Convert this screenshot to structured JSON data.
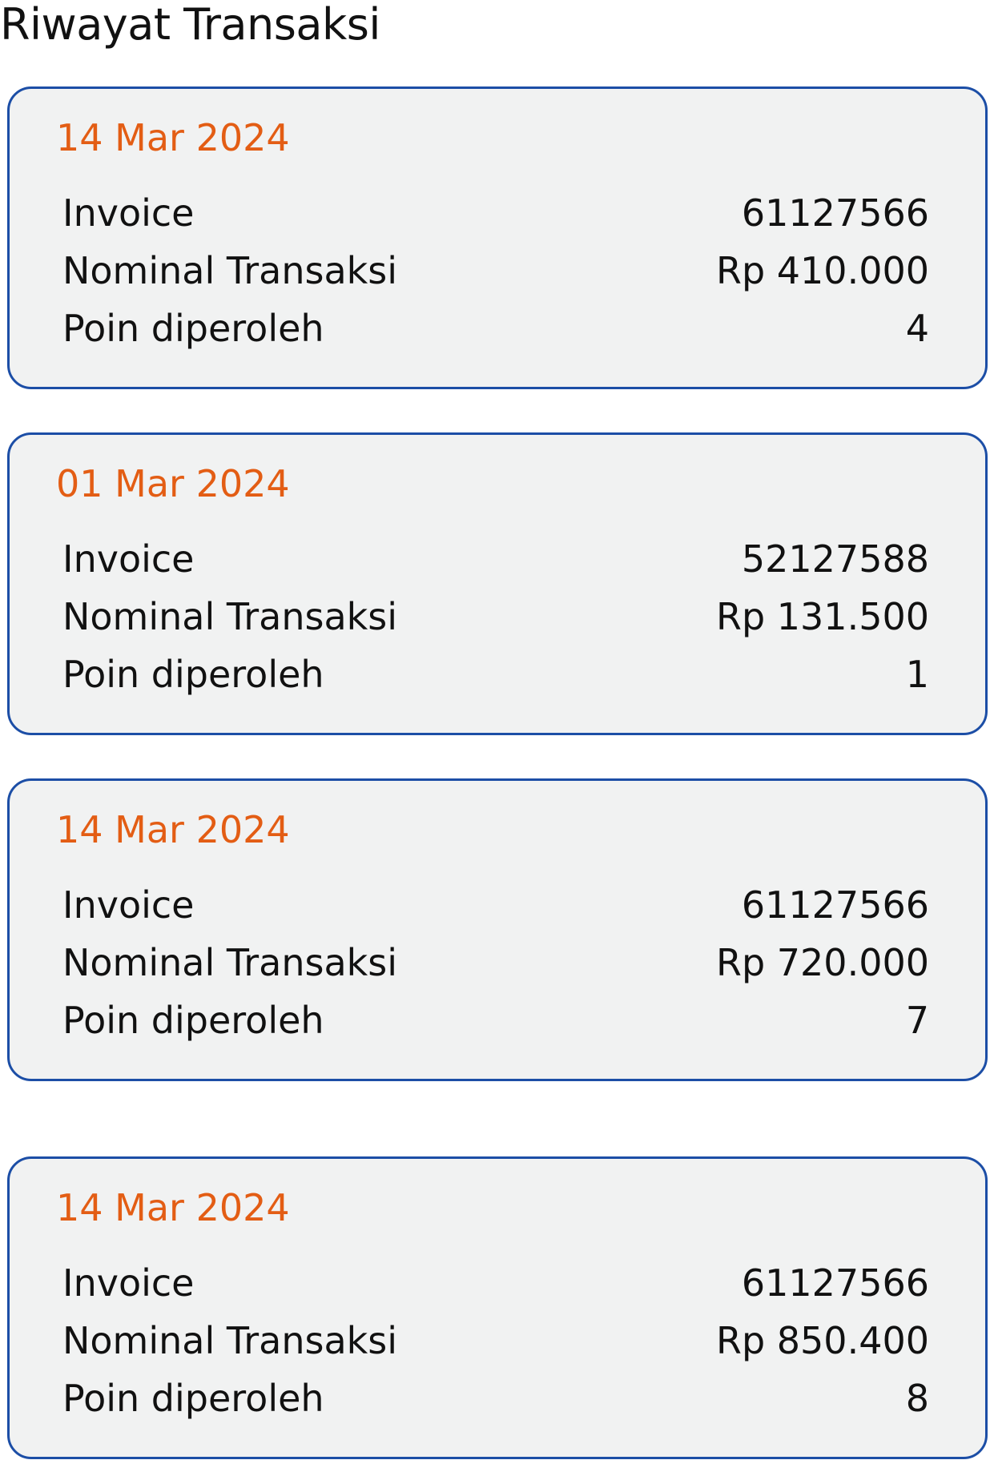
{
  "page": {
    "title": "Riwayat Transaksi"
  },
  "colors": {
    "accent_date": "#e35d14",
    "card_border": "#1c4ea6",
    "card_background": "#f1f2f2"
  },
  "transactions": [
    {
      "date": "14 Mar 2024",
      "invoice_label": "Invoice",
      "invoice": "61127566",
      "nominal_label": "Nominal Transaksi",
      "nominal": "Rp 410.000",
      "points_label": "Poin diperoleh",
      "points": "4"
    },
    {
      "date": "01 Mar 2024",
      "invoice_label": "Invoice",
      "invoice": "52127588",
      "nominal_label": "Nominal Transaksi",
      "nominal": "Rp 131.500",
      "points_label": "Poin diperoleh",
      "points": "1"
    },
    {
      "date": "14 Mar 2024",
      "invoice_label": "Invoice",
      "invoice": "61127566",
      "nominal_label": "Nominal Transaksi",
      "nominal": "Rp 720.000",
      "points_label": "Poin diperoleh",
      "points": "7"
    },
    {
      "date": "14 Mar 2024",
      "invoice_label": "Invoice",
      "invoice": "61127566",
      "nominal_label": "Nominal Transaksi",
      "nominal": "Rp 850.400",
      "points_label": "Poin diperoleh",
      "points": "8"
    }
  ]
}
